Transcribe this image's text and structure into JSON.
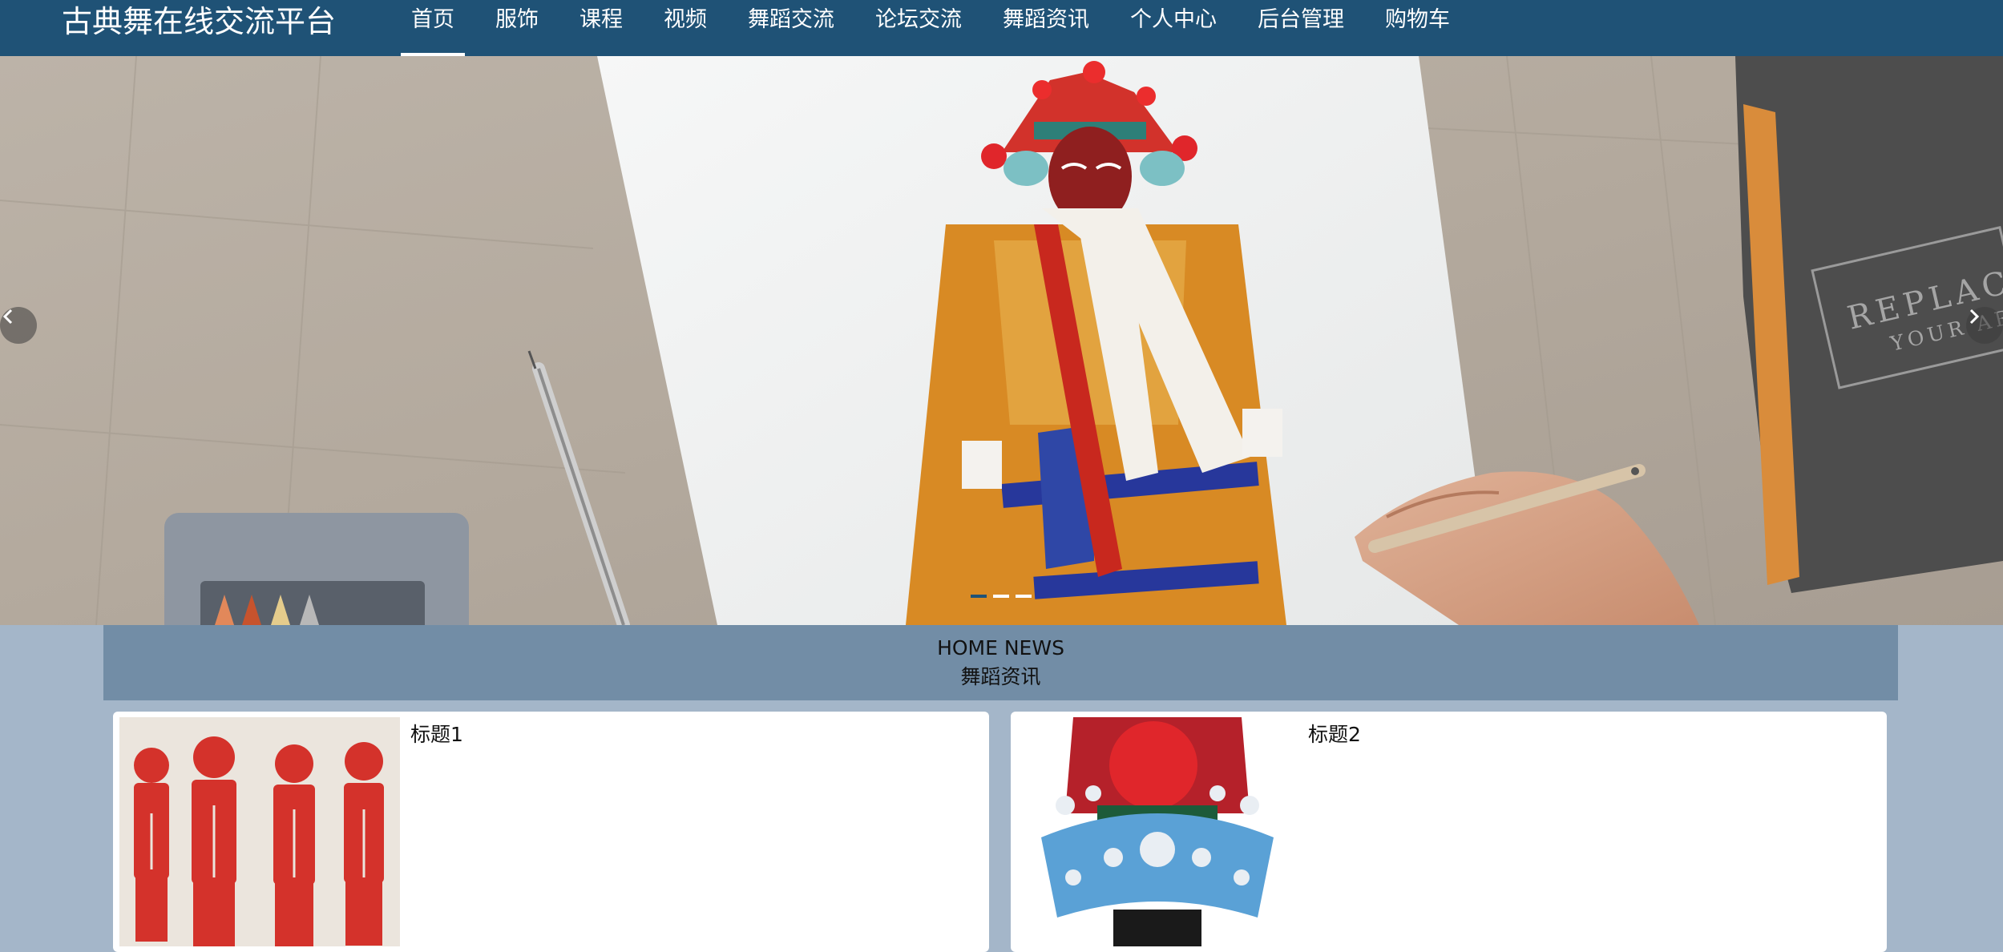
{
  "header": {
    "brand": "古典舞在线交流平台",
    "nav": [
      "首页",
      "服饰",
      "课程",
      "视频",
      "舞蹈交流",
      "论坛交流",
      "舞蹈资讯",
      "个人中心",
      "后台管理",
      "购物车"
    ]
  },
  "banner": {
    "artwork_text": [
      "REPLAC",
      "YOUR AR"
    ],
    "slide_count": 3,
    "active_slide": 1
  },
  "news": {
    "title_en": "HOME NEWS",
    "title_cn": "舞蹈资讯",
    "items": [
      {
        "title": "标题1"
      },
      {
        "title": "标题2"
      }
    ]
  },
  "colors": {
    "nav_bg": "#1f5276",
    "page_bg": "#a4b6c9",
    "news_header_bg": "#728da6"
  }
}
